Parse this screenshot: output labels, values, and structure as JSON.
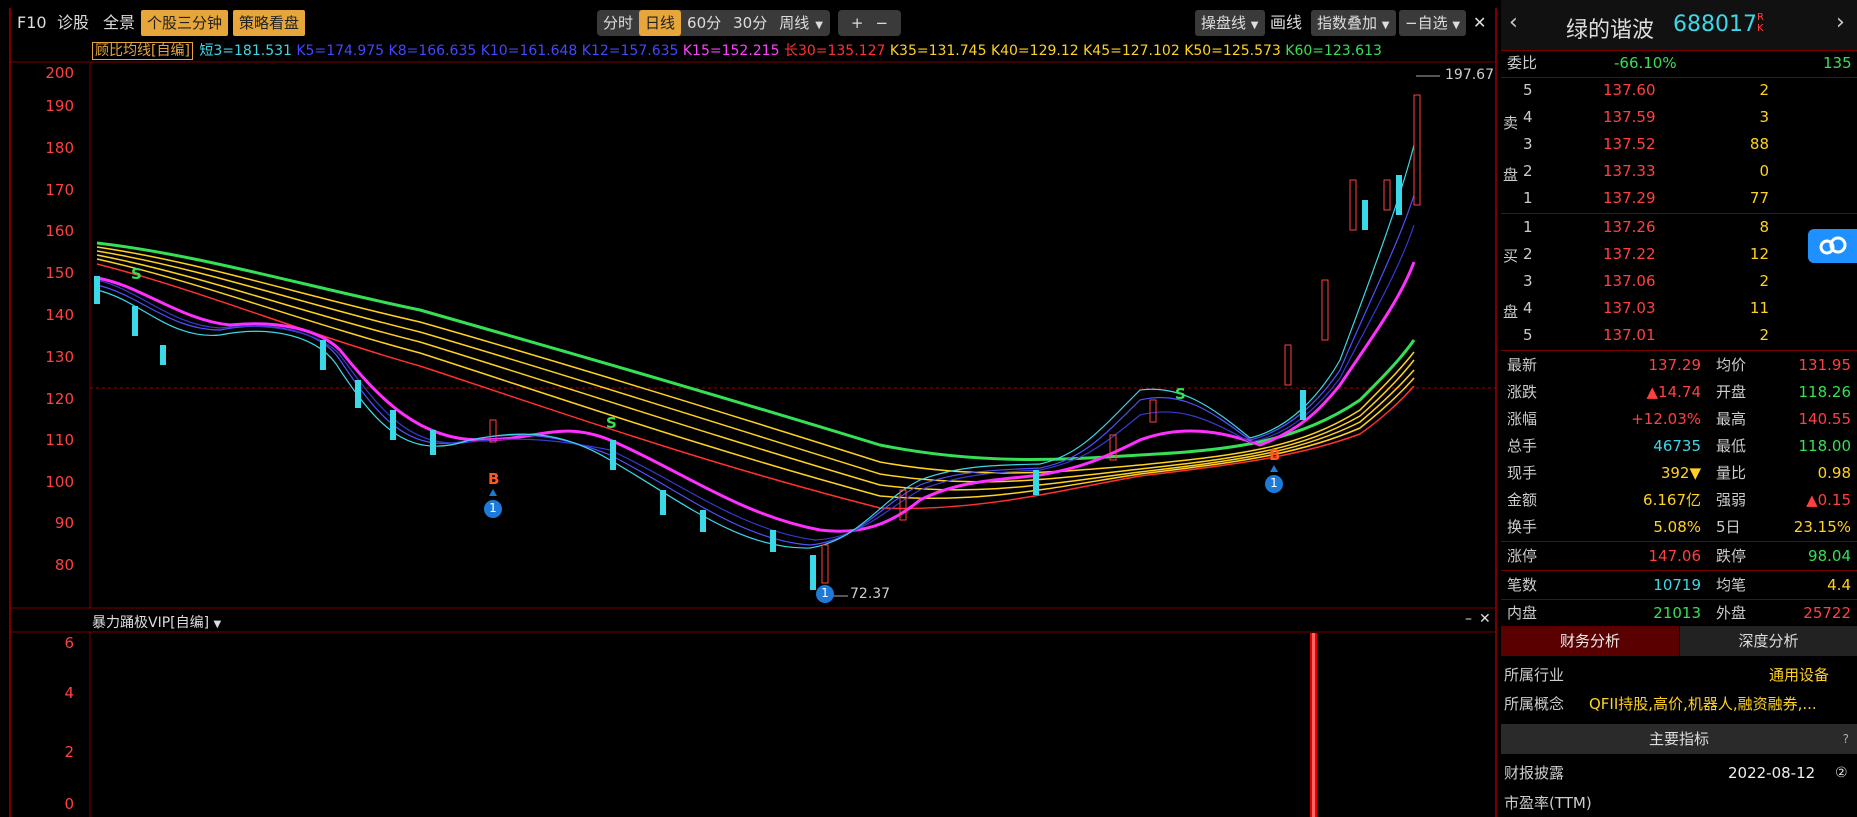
{
  "toolbar": {
    "f10": "F10",
    "diagnose": "诊股",
    "full": "全景",
    "three_min": "个股三分钟",
    "strategy": "策略看盘",
    "periods": [
      "分时",
      "日线",
      "60分",
      "30分",
      "周线"
    ],
    "active_period": "日线",
    "zoom_in": "+",
    "zoom_out": "−",
    "trade_line": "操盘线",
    "draw": "画线",
    "index_overlay": "指数叠加",
    "self_select": "−自选",
    "collapse": "✕"
  },
  "indicator": {
    "name": "顾比均线[自编]",
    "values": [
      {
        "text": "短3=181.531",
        "color": "#3bd8e8"
      },
      {
        "text": "K5=174.975",
        "color": "#4646ff"
      },
      {
        "text": "K8=166.635",
        "color": "#4646ff"
      },
      {
        "text": "K10=161.648",
        "color": "#4646ff"
      },
      {
        "text": "K12=157.635",
        "color": "#4646ff"
      },
      {
        "text": "K15=152.215",
        "color": "#ff40ff"
      },
      {
        "text": "长30=135.127",
        "color": "#ff3030"
      },
      {
        "text": "K35=131.745",
        "color": "#ffd21e"
      },
      {
        "text": "K40=129.12",
        "color": "#ffd21e"
      },
      {
        "text": "K45=127.102",
        "color": "#ffd21e"
      },
      {
        "text": "K50=125.573",
        "color": "#ffd21e"
      },
      {
        "text": "K60=123.613",
        "color": "#35e055"
      }
    ]
  },
  "price_axis": [
    "200",
    "190",
    "180",
    "170",
    "160",
    "150",
    "140",
    "130",
    "120",
    "110",
    "100",
    "90",
    "80"
  ],
  "annotations": {
    "high": "197.67",
    "low": "72.37",
    "buy": "B",
    "sell": "S",
    "marker": "1"
  },
  "lower_panel": {
    "title": "暴力踊极VIP[自编]",
    "axis": [
      "6",
      "4",
      "2",
      "0"
    ]
  },
  "stock": {
    "name": "绿的谐波",
    "code": "688017",
    "rk": "R K"
  },
  "order_book": {
    "weibi_label": "委比",
    "weibi": "-66.10%",
    "weibi_diff": "135",
    "sell_label": [
      "卖",
      "盘"
    ],
    "buy_label": [
      "买",
      "盘"
    ],
    "asks": [
      {
        "level": "5",
        "price": "137.60",
        "vol": "2"
      },
      {
        "level": "4",
        "price": "137.59",
        "vol": "3"
      },
      {
        "level": "3",
        "price": "137.52",
        "vol": "88"
      },
      {
        "level": "2",
        "price": "137.33",
        "vol": "0"
      },
      {
        "level": "1",
        "price": "137.29",
        "vol": "77"
      }
    ],
    "bids": [
      {
        "level": "1",
        "price": "137.26",
        "vol": "8"
      },
      {
        "level": "2",
        "price": "137.22",
        "vol": "12"
      },
      {
        "level": "3",
        "price": "137.06",
        "vol": "2"
      },
      {
        "level": "4",
        "price": "137.03",
        "vol": "11"
      },
      {
        "level": "5",
        "price": "137.01",
        "vol": "2"
      }
    ]
  },
  "quote": [
    {
      "l": "最新",
      "v": "137.29",
      "lc": "red",
      "l2": "均价",
      "v2": "131.95",
      "c2": "red"
    },
    {
      "l": "涨跌",
      "v": "▲14.74",
      "lc": "red",
      "l2": "开盘",
      "v2": "118.26",
      "c2": "green"
    },
    {
      "l": "涨幅",
      "v": "+12.03%",
      "lc": "red",
      "l2": "最高",
      "v2": "140.55",
      "c2": "red"
    },
    {
      "l": "总手",
      "v": "46735",
      "lc": "cyan",
      "l2": "最低",
      "v2": "118.00",
      "c2": "green"
    },
    {
      "l": "现手",
      "v": "392▼",
      "lc": "green",
      "l2": "量比",
      "v2": "0.98",
      "c2": "cyan"
    },
    {
      "l": "金额",
      "v": "6.167亿",
      "lc": "yellow",
      "l2": "强弱",
      "v2": "▲0.15",
      "c2": "red"
    },
    {
      "l": "换手",
      "v": "5.08%",
      "lc": "yellow",
      "l2": "5日",
      "v2": "23.15%",
      "c2": "yellow"
    },
    {
      "l": "涨停",
      "v": "147.06",
      "lc": "red",
      "l2": "跌停",
      "v2": "98.04",
      "c2": "green"
    },
    {
      "l": "笔数",
      "v": "10719",
      "lc": "cyan",
      "l2": "均笔",
      "v2": "4.4",
      "c2": "yellow"
    },
    {
      "l": "内盘",
      "v": "21013",
      "lc": "green",
      "l2": "外盘",
      "v2": "25722",
      "c2": "red"
    }
  ],
  "tabs": {
    "finance": "财务分析",
    "depth": "深度分析"
  },
  "industry": {
    "label": "所属行业",
    "value": "通用设备"
  },
  "concept": {
    "label": "所属概念",
    "value": "QFII持股,高价,机器人,融资融券,..."
  },
  "indicators_header": "主要指标",
  "report": {
    "label": "财报披露",
    "value": "2022-08-12"
  },
  "pe": {
    "label": "市盈率(TTM)"
  },
  "colors": {
    "red": "#ff4040",
    "green": "#35e055",
    "yellow": "#ffd21e",
    "cyan": "#3bd8e8",
    "magenta": "#ff30ff",
    "orange": "#e6a63a"
  }
}
